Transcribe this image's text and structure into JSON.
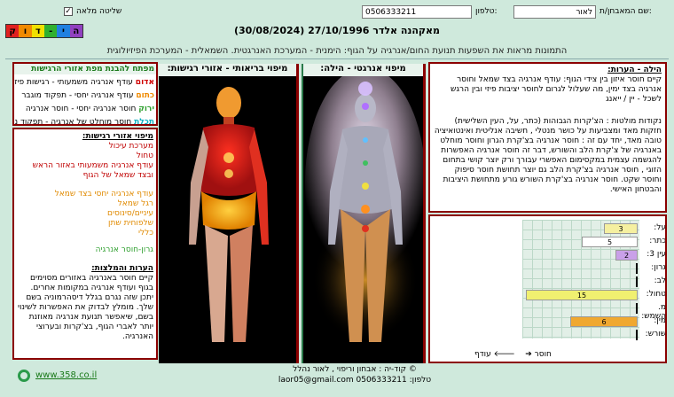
{
  "header": {
    "examinee_label": "שם המאבחן/ת:",
    "examinee_value": "לאור",
    "phone_label": "טלפון:",
    "phone_value": "0506333211",
    "full_control_label": "שליטה מלאה",
    "full_control_checked": true,
    "logo_letters": [
      "ק",
      "ו",
      "ד",
      "-",
      "י",
      "ה"
    ],
    "logo_colors": [
      "#e02020",
      "#f08a00",
      "#f0e000",
      "#30b030",
      "#2080e0",
      "#9040c0"
    ]
  },
  "title": "מאקהנה אלדר  27/10/1996  (30/08/2024)",
  "subtitle": "התמונות מראות את השפעות תנועת החום/אנרגיה על הגוף: הימנית - המערכת האנרגטית. השמאלית - המערכת הפיזיולוגית",
  "legend": {
    "title": "מפתח להבנת מפת אזורי הרגישות",
    "rows": [
      {
        "color_name": "אדום",
        "color": "#d00000",
        "text": "עודף אנרגיה משמעותי - רגישות פיזית"
      },
      {
        "color_name": "כתום",
        "color": "#f08a00",
        "text": "עודף אנרגיה יחסי - תפקוד מוגבר"
      },
      {
        "color_name": "ירוק",
        "color": "#30a030",
        "text": "חוסר אנרגיה יחסי - חוסר אנרגיה"
      },
      {
        "color_name": "תכלת",
        "color": "#10b0c0",
        "text": "חוסר מוחלט של אנרגיה - תפקוד נמוך"
      }
    ]
  },
  "sensitivity": {
    "title": "מיפוי אזורי רגישות:",
    "red_items": [
      "מערכת עיכול",
      "טחול",
      "עודף אנרגיה משמעותי באזור הראש",
      "ובצד שמאל של הגוף"
    ],
    "orange_items": [
      "עודף אנרגיה יחסי בצד שמאל",
      "רגל שמאל",
      "עיניים/סינוסים",
      "שלפוחית שתן",
      "כללי"
    ],
    "green_items": [
      "גרון-חוסר אנרגיה"
    ],
    "notes_title": "הערות והמלצות:",
    "notes_text": "קיים חוסר באנרגיה באזורים מסוימים בגוף ועודף אנרגיה במקומות אחרים. יתכן שזה נגרם בגלל דיסהרמוניה בשם שלך. מומלץ לבדוק את האפשרות לשינוי בשם, שיאפשר תנועת אנרגיה מאוזנת יותר לאברי הגוף, בצ'קרות ובערוצי האנרגיה."
  },
  "images": {
    "physical_title": "מיפוי בריאותי - אזורי רגישות:",
    "energy_title": "מיפוי אנרגטי - הילה:"
  },
  "aura": {
    "title": "הילה - הערות:",
    "paragraph1": "קיים חוסר איזון בין צידי הגוף: עודף אנרגיה בצד שמאל וחוסר אנרגיה בצד ימין, מה שעלול לגרום לחוסר יציבות פיזי ובין הרגש לשכל - יין / ייאנג",
    "paragraph2": "נקודות מולטות : הצ'קרות הגבוהות (כתר, על, העין השלישית) חזקות מאד ומצביעות על כושר מנטלי , חשיבה אנליטית ואינטואיציה טובה מאד, יחד עם זה : חוסר אנרגיה בצ'קרת הגרון וחוסר מוחלט באנרגיה של צ'קרת הלב והשורש, דבר זה חוסר אנרגיה האפשרות להגשמה עצמית במקסימום האפשרי עבורך ורק יוצר קושי בתחום הזוגי , חוסר אנרגיה בצ'קרת הלב גם יוצר תחושת חוסר סיפוק וחוסר שקט. חוסר אנרגיה בצ'קרת השורש גורע מתחושת היציבות והבטחון האישי."
  },
  "chakras": {
    "rows": [
      {
        "label": "על:",
        "value": "3",
        "color": "#f5f0a0",
        "fill": 0.3
      },
      {
        "label": "כתר:",
        "value": "5",
        "color": "#ffffff",
        "fill": 0.5
      },
      {
        "label": "עין 3:",
        "value": "2",
        "color": "#c9a0e8",
        "fill": 0.2
      },
      {
        "label": "גרון:",
        "value": "",
        "color": "#ffffff",
        "fill": 0
      },
      {
        "label": "לב:",
        "value": "",
        "color": "#ffffff",
        "fill": 0
      },
      {
        "label": "טחול:",
        "value": "15",
        "color": "#f0f070",
        "fill": 1.0
      },
      {
        "label": "מ. השמש:",
        "value": "",
        "color": "#ffffff",
        "fill": 0
      },
      {
        "label": "מין:",
        "value": "6",
        "color": "#f0a830",
        "fill": 0.6
      },
      {
        "label": "שורש:",
        "value": "",
        "color": "#ffffff",
        "fill": 0
      }
    ],
    "deficit_label": "חוסר",
    "excess_label": "עודף"
  },
  "footer": {
    "copyright": "© קוד-יה : אבחון וריפוי , לאור נהלל",
    "phone_line": "טלפון: 0506333211  laor05@gmail.com",
    "website": "www.358.co.il"
  }
}
